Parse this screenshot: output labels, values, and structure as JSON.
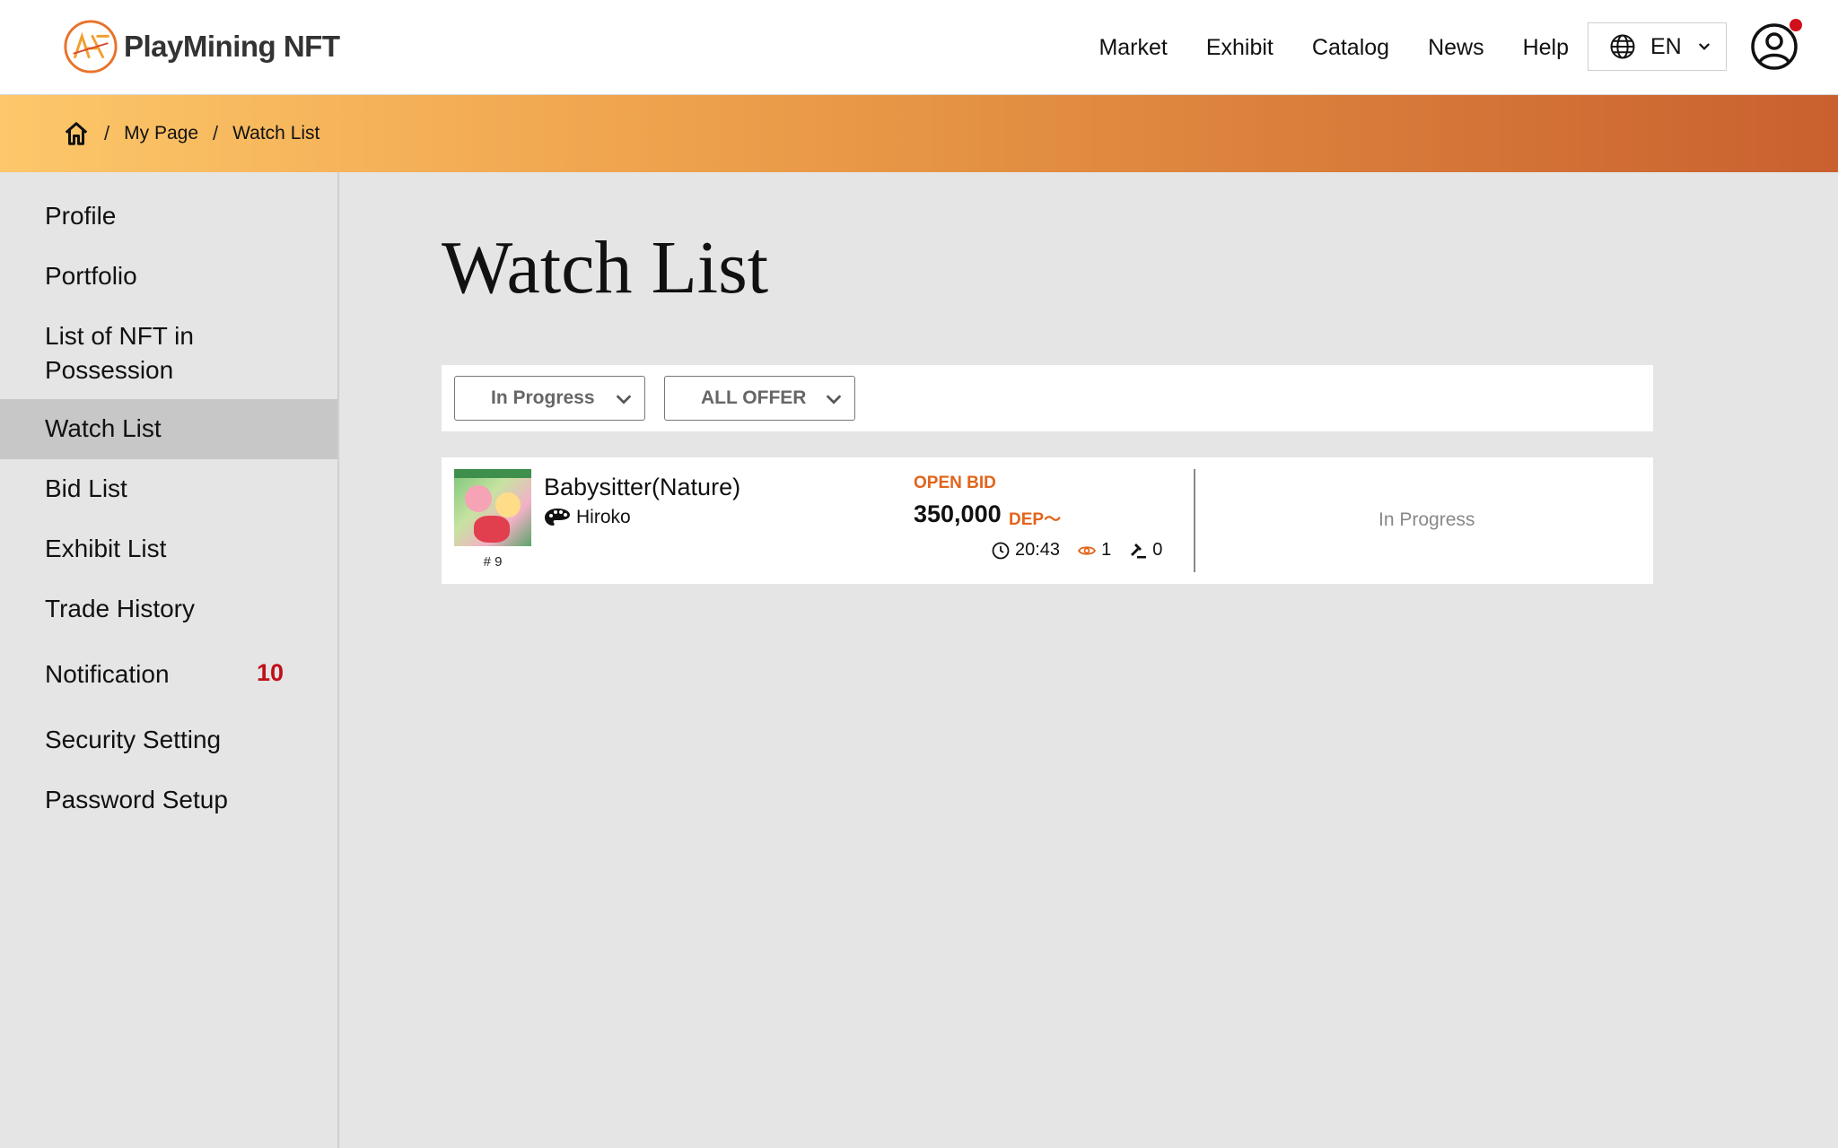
{
  "header": {
    "logo_text": "PlayMining NFT",
    "nav": [
      {
        "label": "Market"
      },
      {
        "label": "Exhibit"
      },
      {
        "label": "Catalog"
      },
      {
        "label": "News"
      },
      {
        "label": "Help"
      }
    ],
    "language": "EN",
    "icons": {
      "language": "globe-icon",
      "user": "user-circle-icon"
    },
    "notification_dot_color": "#d10f1a"
  },
  "breadcrumb": {
    "items": [
      {
        "label": "My Page"
      },
      {
        "label": "Watch List"
      }
    ]
  },
  "sidebar": {
    "items": [
      {
        "label": "Profile"
      },
      {
        "label": "Portfolio"
      },
      {
        "label": "List of NFT in"
      },
      {
        "label": "Possession"
      },
      {
        "label": "Watch List"
      },
      {
        "label": "Bid List"
      },
      {
        "label": "Exhibit List"
      },
      {
        "label": "Trade History"
      },
      {
        "label": "Notification",
        "badge": "10"
      },
      {
        "label": "Security Setting"
      },
      {
        "label": "Password Setup"
      }
    ],
    "active": "Watch List"
  },
  "main": {
    "title": "Watch List",
    "filters": {
      "status": "In Progress",
      "offer_type": "ALL OFFER"
    },
    "items": [
      {
        "name": "Babysitter(Nature)",
        "creator": "Hiroko",
        "token_id": "# 9",
        "offer_label": "OPEN BID",
        "price": "350,000",
        "currency": "DEP～",
        "time_left": "20:43",
        "views": "1",
        "bids": "0",
        "status": "In Progress"
      }
    ]
  },
  "colors": {
    "accent_orange": "#e2641b",
    "badge_red": "#c10f18",
    "gradient_start": "#fdc76a",
    "gradient_end": "#c9602f"
  }
}
